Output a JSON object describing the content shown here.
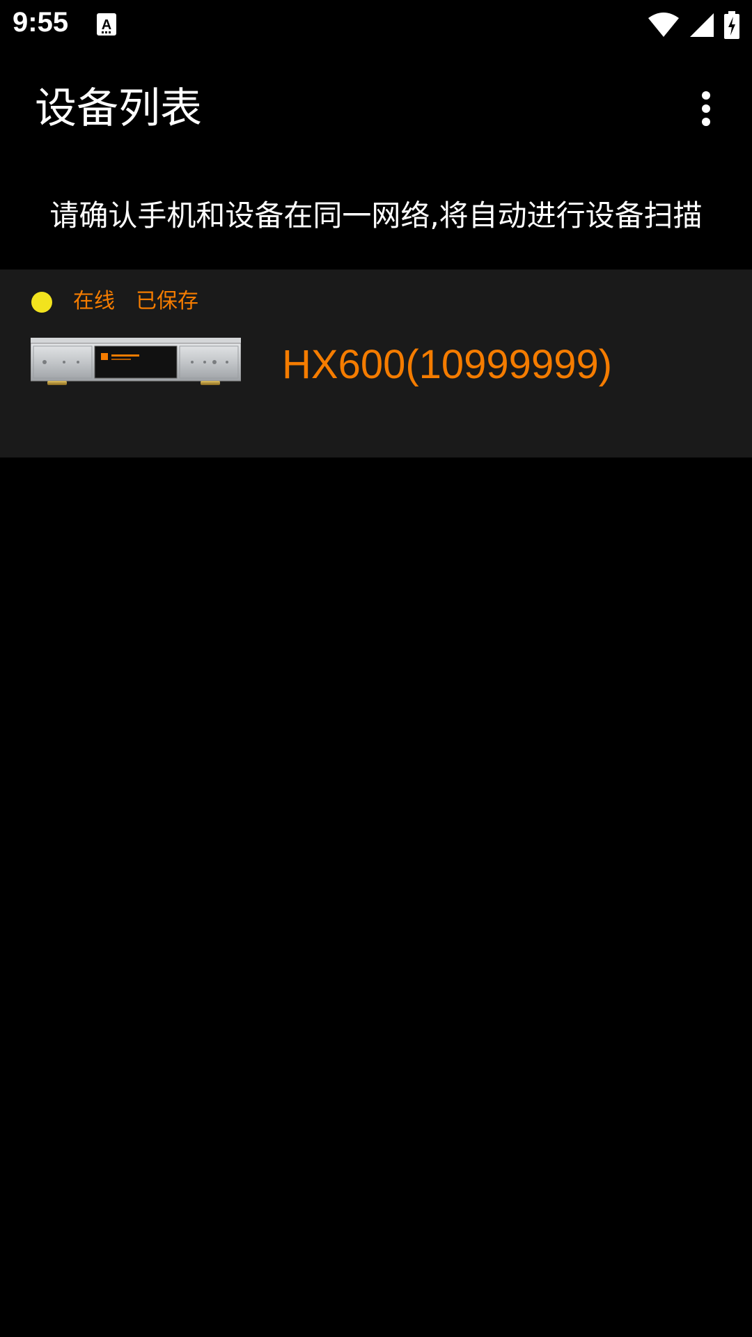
{
  "status_bar": {
    "time": "9:55",
    "notification_icon": "a-letter-icon",
    "icons": [
      "wifi-icon",
      "cell-signal-icon",
      "battery-charging-icon"
    ]
  },
  "app_bar": {
    "title": "设备列表",
    "menu_icon": "more-vert-icon"
  },
  "hint": "请确认手机和设备在同一网络,将自动进行设备扫描",
  "devices": [
    {
      "status_online": "在线",
      "status_saved": "已保存",
      "name": "HX600(10999999)",
      "image": "hx600-player-image"
    }
  ],
  "colors": {
    "background": "#000000",
    "card": "#1a1a1a",
    "accent_orange": "#f57c00",
    "dot_yellow": "#f2e31e"
  }
}
